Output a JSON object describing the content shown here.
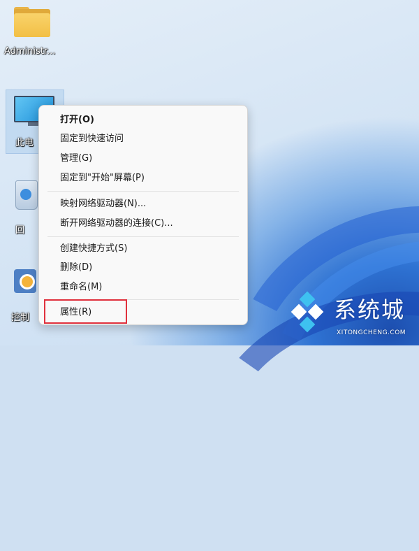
{
  "desktop": {
    "icons": [
      {
        "label": "Administr...",
        "icon": "folder-icon"
      },
      {
        "label": "此电",
        "icon": "this-pc-icon"
      },
      {
        "label": "回",
        "icon": "recycle-bin-icon"
      },
      {
        "label": "控制",
        "icon": "control-panel-icon"
      }
    ]
  },
  "context_menu": {
    "groups": [
      [
        "打开(O)",
        "固定到快速访问",
        "管理(G)",
        "固定到\"开始\"屏幕(P)"
      ],
      [
        "映射网络驱动器(N)...",
        "断开网络驱动器的连接(C)..."
      ],
      [
        "创建快捷方式(S)",
        "删除(D)",
        "重命名(M)"
      ],
      [
        "属性(R)"
      ]
    ],
    "highlighted_item": "属性(R)",
    "highlight_color": "#e0313d"
  },
  "watermark": {
    "text": "系统城",
    "url_text": "XITONGCHENG.COM"
  }
}
